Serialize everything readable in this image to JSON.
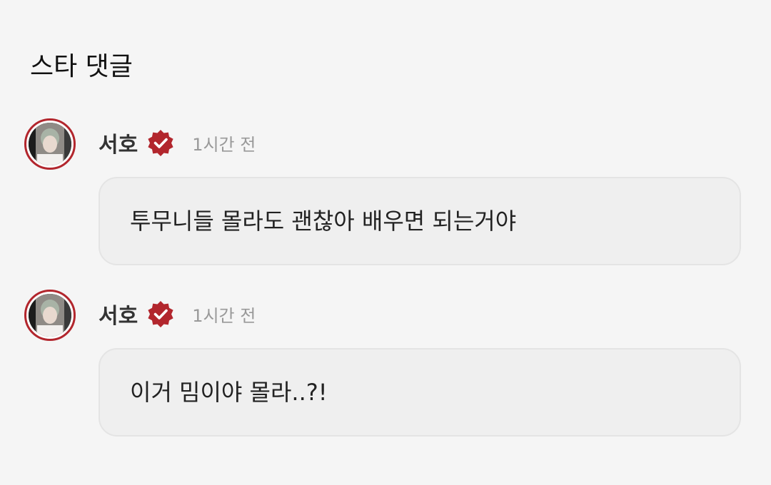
{
  "section": {
    "title": "스타 댓글"
  },
  "comments": [
    {
      "author": "서호",
      "time": "1시간 전",
      "text": "투무니들 몰라도 괜찮아 배우면 되는거야",
      "verified_icon": "verified-badge-icon"
    },
    {
      "author": "서호",
      "time": "1시간 전",
      "text": "이거 밈이야 몰라..?!",
      "verified_icon": "verified-badge-icon"
    }
  ],
  "colors": {
    "accent": "#b2262d",
    "background": "#f5f5f5",
    "bubble": "#efefef",
    "muted_text": "#999999"
  }
}
